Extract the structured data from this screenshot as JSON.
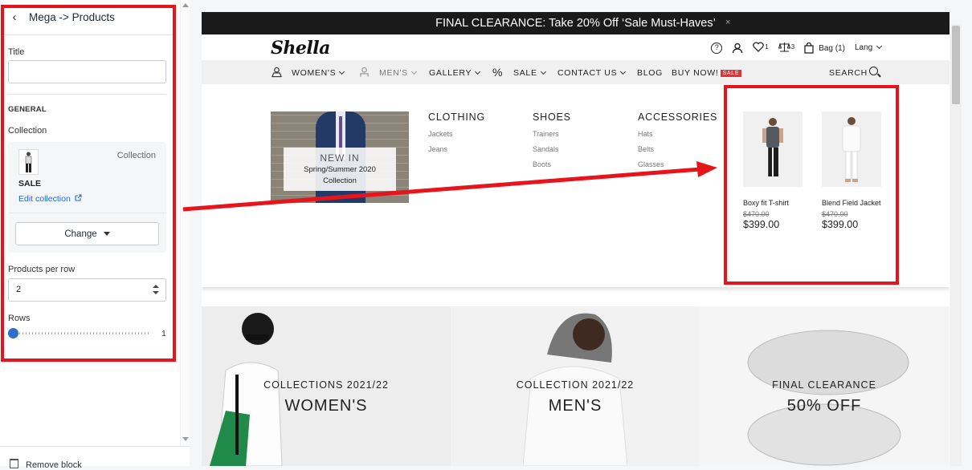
{
  "editor": {
    "back_icon": "chevron-left-icon",
    "title": "Mega -> Products",
    "title_label": "Title",
    "title_value": "",
    "general_heading": "GENERAL",
    "collection_label": "Collection",
    "collection": {
      "type": "Collection",
      "name": "SALE",
      "edit_link": "Edit collection",
      "change_button": "Change"
    },
    "products_per_row_label": "Products per row",
    "products_per_row_value": "2",
    "rows_label": "Rows",
    "rows_value": "1",
    "rows_level": 0,
    "remove_block": "Remove block"
  },
  "preview": {
    "announcement": "FINAL CLEARANCE: Take 20% Off ‘Sale Must-Haves’",
    "announcement_close": "×",
    "logo": "Shella",
    "wishlist_count": "1",
    "compare_count": "3",
    "bag_label": "Bag (1)",
    "lang_label": "Lang",
    "nav": {
      "womens": "WOMEN'S",
      "mens": "MEN'S",
      "gallery": "GALLERY",
      "percent": "%",
      "sale": "SALE",
      "contact": "CONTACT US",
      "blog": "BLOG",
      "buy_now": "BUY NOW!",
      "buy_now_badge": "SALE",
      "search": "SEARCH"
    },
    "mega": {
      "promo_title": "NEW IN",
      "promo_line1": "Spring/Summer 2020",
      "promo_line2": "Collection",
      "columns": [
        {
          "heading": "CLOTHING",
          "items": [
            "Jackets",
            "Jeans"
          ]
        },
        {
          "heading": "SHOES",
          "items": [
            "Trainers",
            "Sandals",
            "Boots"
          ]
        },
        {
          "heading": "ACCESSORIES",
          "items": [
            "Hats",
            "Belts",
            "Glasses"
          ]
        }
      ],
      "products": [
        {
          "name": "Boxy fit T-shirt",
          "old_price": "$470.00",
          "price": "$399.00"
        },
        {
          "name": "Blend Field Jacket",
          "old_price": "$470.00",
          "price": "$399.00"
        }
      ]
    },
    "heroes": [
      {
        "sub": "COLLECTIONS 2021/22",
        "title": "WOMEN'S"
      },
      {
        "sub": "COLLECTION 2021/22",
        "title": "MEN'S"
      },
      {
        "sub": "FINAL CLEARANCE",
        "title": "50% OFF"
      }
    ]
  },
  "colors": {
    "highlight": "#e8141c",
    "link": "#1c6bd8",
    "slider": "#2c6ecb",
    "sale_badge": "#e0343a"
  }
}
